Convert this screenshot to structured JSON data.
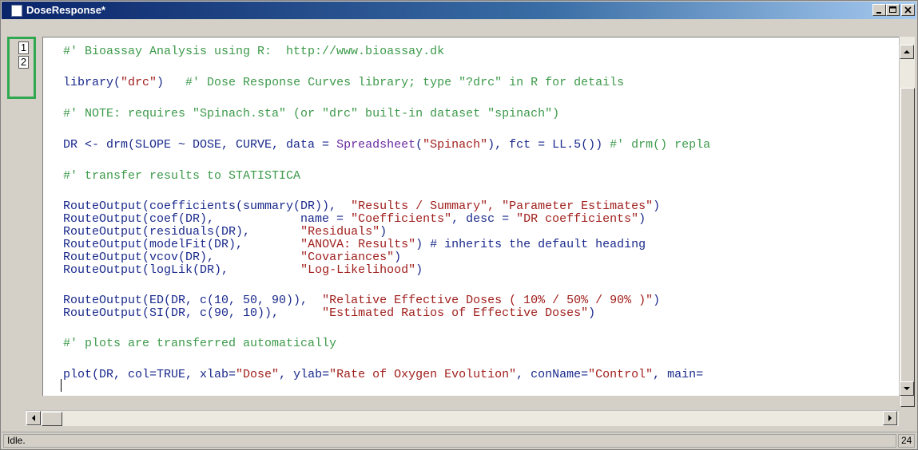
{
  "window": {
    "title": "DoseResponse*"
  },
  "gutter": {
    "line_numbers": [
      "1",
      "2"
    ]
  },
  "code": {
    "line1": {
      "comment": "#' Bioassay Analysis using R:  http://www.bioassay.dk"
    },
    "line2": {
      "code": "library(",
      "str": "\"drc\"",
      "code2": ")   ",
      "comment": "#' Dose Response Curves library; type \"?drc\" in R for details"
    },
    "line3": {
      "comment": "#' NOTE: requires \"Spinach.sta\" (or \"drc\" built-in dataset \"spinach\")"
    },
    "line4": {
      "code": "DR <- drm(SLOPE ~ DOSE, CURVE, data = ",
      "kw": "Spreadsheet",
      "code2": "(",
      "str": "\"Spinach\"",
      "code3": "), fct = LL.5()) ",
      "comment": "#' drm() repla"
    },
    "line5": {
      "comment": "#' transfer results to STATISTICA"
    },
    "line6": {
      "code": "RouteOutput(coefficients(summary(DR)),  ",
      "str": "\"Results / Summary\", \"Parameter Estimates\"",
      "code2": ")"
    },
    "line7": {
      "code": "RouteOutput(coef(DR),            name = ",
      "str": "\"Coefficients\"",
      "code2": ", desc = ",
      "str2": "\"DR coefficients\"",
      "code3": ")"
    },
    "line8": {
      "code": "RouteOutput(residuals(DR),       ",
      "str": "\"Residuals\"",
      "code2": ")"
    },
    "line9": {
      "code": "RouteOutput(modelFit(DR),        ",
      "str": "\"ANOVA: Results\"",
      "code2": ") # inherits the default heading"
    },
    "line10": {
      "code": "RouteOutput(vcov(DR),            ",
      "str": "\"Covariances\"",
      "code2": ")"
    },
    "line11": {
      "code": "RouteOutput(logLik(DR),          ",
      "str": "\"Log-Likelihood\"",
      "code2": ")"
    },
    "line12": {
      "code": "RouteOutput(ED(DR, c(10, 50, 90)),  ",
      "str": "\"Relative Effective Doses ( 10% / 50% / 90% )\"",
      "code2": ")"
    },
    "line13": {
      "code": "RouteOutput(SI(DR, c(90, 10)),      ",
      "str": "\"Estimated Ratios of Effective Doses\"",
      "code2": ")"
    },
    "line14": {
      "comment": "#' plots are transferred automatically"
    },
    "line15": {
      "code": "plot(DR, col=TRUE, xlab=",
      "str": "\"Dose\"",
      "code2": ", ylab=",
      "str2": "\"Rate of Oxygen Evolution\"",
      "code3": ", conName=",
      "str3": "\"Control\"",
      "code4": ", main="
    }
  },
  "status": {
    "text": "Idle.",
    "right": "24"
  }
}
